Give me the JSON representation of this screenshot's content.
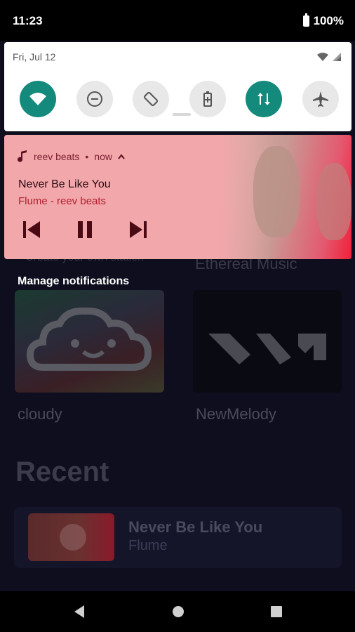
{
  "status": {
    "time": "11:23",
    "battery": "100%"
  },
  "quick_settings": {
    "date": "Fri, Jul 12",
    "tiles": [
      {
        "name": "wifi-icon",
        "on": true
      },
      {
        "name": "dnd-icon",
        "on": false
      },
      {
        "name": "auto-rotate-icon",
        "on": false
      },
      {
        "name": "battery-saver-icon",
        "on": false
      },
      {
        "name": "mobile-data-icon",
        "on": true
      },
      {
        "name": "airplane-mode-icon",
        "on": false
      }
    ]
  },
  "notification": {
    "app": "reev beats",
    "time": "now",
    "title": "Never Be Like You",
    "subtitle": "Flume - reev beats"
  },
  "manage_label": "Manage notifications",
  "background": {
    "partial_left": "Create your own station",
    "partial_right": "Ethereal Music",
    "cards": [
      {
        "label": "cloudy"
      },
      {
        "label": "NewMelody"
      }
    ],
    "recent_heading": "Recent",
    "recent_item": {
      "title": "Never Be Like You",
      "artist": "Flume"
    }
  },
  "colors": {
    "accent": "#148a7c",
    "notification_bg": "#f2a7ab",
    "notification_text": "#b0202e"
  }
}
